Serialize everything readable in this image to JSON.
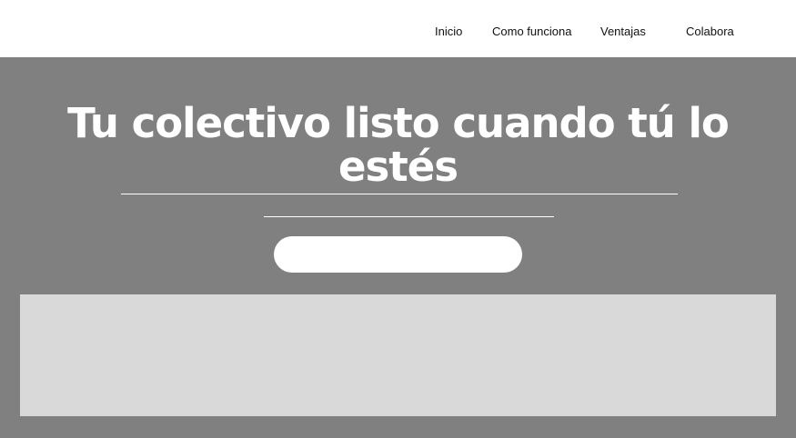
{
  "nav": {
    "items": [
      {
        "label": "Inicio"
      },
      {
        "label": "Como funciona"
      },
      {
        "label": "Ventajas"
      },
      {
        "label": "Colabora"
      }
    ]
  },
  "hero": {
    "title": "Tu colectivo listo cuando tú lo estés",
    "cta_label": ""
  },
  "colors": {
    "nav_background": "#ffffff",
    "hero_background": "#808080",
    "title_color": "#ffffff",
    "placeholder_background": "#d9d9d9"
  }
}
